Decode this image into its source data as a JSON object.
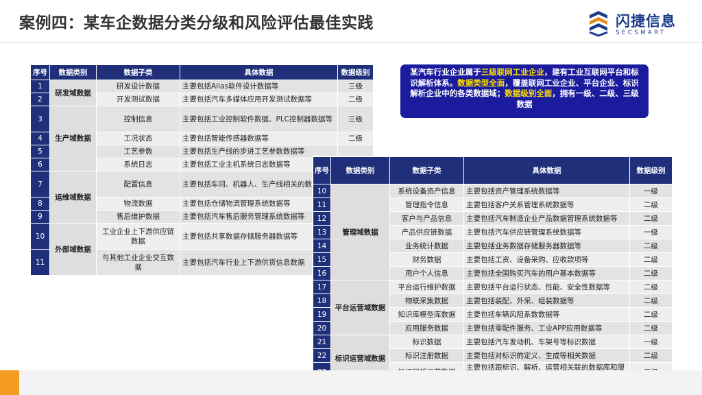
{
  "title": "案例四：某车企数据分类分级和风险评估最佳实践",
  "logo": {
    "cn": "闪捷信息",
    "en": "SECSMART"
  },
  "callout": {
    "parts": [
      {
        "text": "某汽车行业企业属于",
        "hl": false
      },
      {
        "text": "三级联网工业企业",
        "hl": true
      },
      {
        "text": "，建有工业互联网平台和标识解析体系。",
        "hl": false
      },
      {
        "text": "数据类型全面",
        "hl": true
      },
      {
        "text": "，覆盖联网工业企业、平台企业、标识解析企业中的各类数据域；",
        "hl": false
      },
      {
        "text": "数据级别全面",
        "hl": true
      },
      {
        "text": "，拥有一级、二级、三级数据",
        "hl": false
      }
    ]
  },
  "headers": {
    "no": "序号",
    "category": "数据类别",
    "subcategory": "数据子类",
    "detail": "具体数据",
    "level": "数据级别"
  },
  "headers2": {
    "no": "序号",
    "category": "数据类别",
    "subcategory": "数据子类",
    "detail": "具体数据",
    "level": "数据级别"
  },
  "table1": {
    "groups": [
      {
        "category": "研发域数据",
        "rows": [
          {
            "no": "1",
            "sub": "研发设计数据",
            "detail": "主要包括Alias软件设计数据等",
            "level": "三级"
          },
          {
            "no": "2",
            "sub": "开发测试数据",
            "detail": "主要包括汽车多媒体应用开发测试数据等",
            "level": "二级"
          }
        ]
      },
      {
        "category": "生产域数据",
        "rows": [
          {
            "no": "3",
            "sub": "控制信息",
            "detail": "主要包括工业控制软件数据、PLC控制器数据等",
            "level": "三级"
          },
          {
            "no": "4",
            "sub": "工况状态",
            "detail": "主要包括智能传感器数据等",
            "level": "二级"
          },
          {
            "no": "5",
            "sub": "工艺参数",
            "detail": "主要包括生产线的步进工艺参数数据等",
            "level": ""
          },
          {
            "no": "6",
            "sub": "系统日志",
            "detail": "主要包括工业主机系统日志数据等",
            "level": ""
          }
        ]
      },
      {
        "category": "运维域数据",
        "rows": [
          {
            "no": "7",
            "sub": "配置信息",
            "detail": "主要包括车间、机器人、生产线相关的数据等",
            "level": ""
          },
          {
            "no": "8",
            "sub": "物流数据",
            "detail": "主要包括仓储物流管理系统数据等",
            "level": ""
          },
          {
            "no": "9",
            "sub": "售后维护数据",
            "detail": "主要包括汽车售后服务管理系统数据等",
            "level": ""
          }
        ]
      },
      {
        "category": "外部域数据",
        "rows": [
          {
            "no": "10",
            "sub": "工业企业上下游供应链数据",
            "detail": "主要包括共享数据存储服务器数据等",
            "level": ""
          },
          {
            "no": "11",
            "sub": "与其他工业企业交互数据",
            "detail": "主要包括汽车行业上下游供货信息数据",
            "level": ""
          }
        ]
      }
    ]
  },
  "table2": {
    "groups": [
      {
        "category": "管理域数据",
        "rows": [
          {
            "no": "10",
            "sub": "系统设备资产信息",
            "detail": "主要包括资产管理系统数据等",
            "level": "一级"
          },
          {
            "no": "11",
            "sub": "管理指令信息",
            "detail": "主要包括客户关系管理系统数据等",
            "level": "二级"
          },
          {
            "no": "12",
            "sub": "客户与产品信息",
            "detail": "主要包括汽车制造企业产品数据管理系统数据等",
            "level": "二级"
          },
          {
            "no": "13",
            "sub": "产品供应链数据",
            "detail": "主要包括汽车供应链管理系统数据等",
            "level": "一级"
          },
          {
            "no": "14",
            "sub": "业务统计数据",
            "detail": "主要包括业务数据存储服务器数据等",
            "level": "二级"
          },
          {
            "no": "15",
            "sub": "财务数据",
            "detail": "主要包括工资、设备采购、应收款项等",
            "level": "二级"
          },
          {
            "no": "16",
            "sub": "用户个人信息",
            "detail": "主要包括全国购买汽车的用户基本数据等",
            "level": "二级"
          }
        ]
      },
      {
        "category": "平台运营域数据",
        "rows": [
          {
            "no": "17",
            "sub": "平台运行维护数据",
            "detail": "主要包括平台运行状态、性能、安全性数据等",
            "level": "二级"
          },
          {
            "no": "18",
            "sub": "物联采集数据",
            "detail": "主要包括装配、外采、组装数据等",
            "level": "二级"
          },
          {
            "no": "19",
            "sub": "知识库模型库数据",
            "detail": "主要包括车辆风阻系数数据等",
            "level": "二级"
          },
          {
            "no": "20",
            "sub": "应用服务数据",
            "detail": "主要包括零配件服务、工业APP应用数据等",
            "level": "二级"
          }
        ]
      },
      {
        "category": "标识运营域数据",
        "rows": [
          {
            "no": "21",
            "sub": "标识数据",
            "detail": "主要包括汽车发动机、车架号等标识数据",
            "level": "一级"
          },
          {
            "no": "22",
            "sub": "标识注册数据",
            "detail": "主要包括对标识的定义、生成等相关数据",
            "level": "二级"
          },
          {
            "no": "23",
            "sub": "标识解析运营数据",
            "detail": "主要包括跟标识、解析、运营相关联的数据库和服务器存储的数据",
            "level": "三级"
          }
        ]
      }
    ]
  }
}
